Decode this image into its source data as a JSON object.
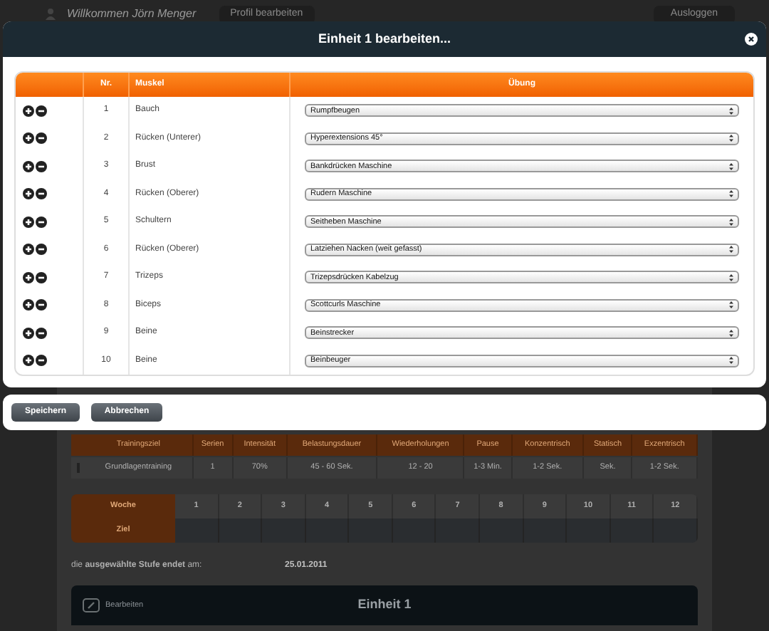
{
  "header": {
    "welcome": "Willkommen Jörn Menger",
    "profile_button": "Profil bearbeiten",
    "logout_button": "Ausloggen"
  },
  "dialog": {
    "title": "Einheit 1 bearbeiten...",
    "columns": [
      "Nr.",
      "Muskel",
      "Übung"
    ],
    "rows": [
      {
        "nr": "1",
        "muscle": "Bauch",
        "exercise": "Rumpfbeugen"
      },
      {
        "nr": "2",
        "muscle": "Rücken (Unterer)",
        "exercise": "Hyperextensions 45°"
      },
      {
        "nr": "3",
        "muscle": "Brust",
        "exercise": "Bankdrücken Maschine"
      },
      {
        "nr": "4",
        "muscle": "Rücken (Oberer)",
        "exercise": "Rudern Maschine"
      },
      {
        "nr": "5",
        "muscle": "Schultern",
        "exercise": "Seitheben Maschine"
      },
      {
        "nr": "6",
        "muscle": "Rücken (Oberer)",
        "exercise": "Latziehen Nacken (weit gefasst)"
      },
      {
        "nr": "7",
        "muscle": "Trizeps",
        "exercise": "Trizepsdrücken Kabelzug"
      },
      {
        "nr": "8",
        "muscle": "Biceps",
        "exercise": "Scottcurls Maschine"
      },
      {
        "nr": "9",
        "muscle": "Beine",
        "exercise": "Beinstrecker"
      },
      {
        "nr": "10",
        "muscle": "Beine",
        "exercise": "Beinbeuger"
      }
    ],
    "buttons": [
      "Speichern",
      "Abbrechen"
    ]
  },
  "training_table": {
    "columns": [
      "Trainingsziel",
      "Serien",
      "Intensität",
      "Belastungsdauer",
      "Wiederholungen",
      "Pause",
      "Konzentrisch",
      "Statisch",
      "Exzentrisch"
    ],
    "row": [
      "Grundlagentraining",
      "1",
      "70%",
      "45 - 60 Sek.",
      "12 - 20",
      "1-3 Min.",
      "1-2 Sek.",
      "Sek.",
      "1-2 Sek."
    ]
  },
  "week_table": {
    "week_label": "Woche",
    "goal_label": "Ziel",
    "weeks": [
      "1",
      "2",
      "3",
      "4",
      "5",
      "6",
      "7",
      "8",
      "9",
      "10",
      "11",
      "12"
    ]
  },
  "stage_end": {
    "label": "die **ausgewählte Stufe endet** am:",
    "date": "25.01.2011"
  },
  "unit_panel": {
    "edit_label": "Bearbeiten",
    "title": "Einheit 1"
  }
}
